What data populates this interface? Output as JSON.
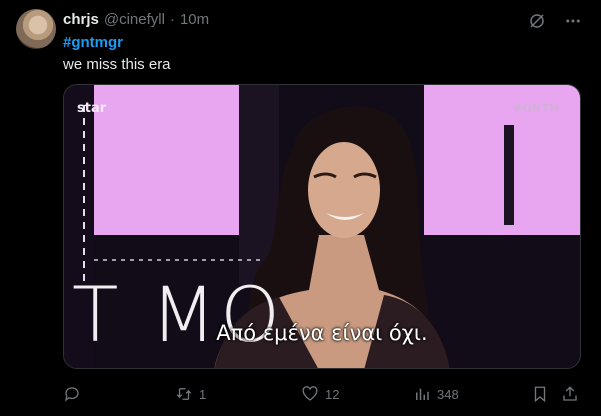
{
  "tweet": {
    "display_name": "chrjs",
    "handle": "@cinefyll",
    "separator": "·",
    "time": "10m",
    "hashtag": "#gntmgr",
    "text": "we miss this era"
  },
  "media": {
    "logo_text": "star",
    "corner_tag": "#GNTM",
    "background_text": "T    MO",
    "subtitle": "Από εμένα είναι όχι."
  },
  "actions": {
    "reply_count": "",
    "repost_count": "1",
    "like_count": "12",
    "views_count": "348"
  },
  "icons": {
    "grok": "grok-icon",
    "more": "more-icon",
    "reply": "reply-icon",
    "repost": "repost-icon",
    "like": "heart-icon",
    "views": "views-icon",
    "bookmark": "bookmark-icon",
    "share": "share-icon"
  },
  "colors": {
    "background": "#000000",
    "accent": "#1d9bf0",
    "muted": "#71767b",
    "panel": "#e8a6f0"
  }
}
